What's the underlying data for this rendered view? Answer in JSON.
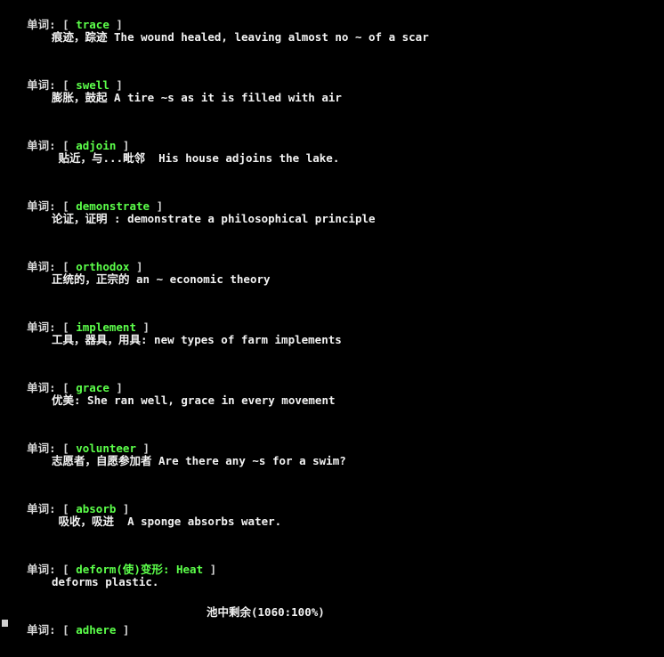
{
  "terminal": {
    "prefix": "单词:",
    "open_bracket": "[",
    "close_bracket": "]",
    "status": "池中剩余(1060:100%)",
    "colors": {
      "background": "#000000",
      "word": "#5cff4a",
      "text": "#f2f2f2"
    }
  },
  "entries": [
    {
      "word": "trace",
      "def": "痕迹，踪迹 The wound healed, leaving almost no ~ of a scar"
    },
    {
      "word": "swell",
      "def": "膨胀，鼓起 A tire ~s as it is filled with air"
    },
    {
      "word": "adjoin",
      "def": " 贴近，与...毗邻  His house adjoins the lake."
    },
    {
      "word": "demonstrate",
      "def": "论证，证明 : demonstrate a philosophical principle"
    },
    {
      "word": "orthodox",
      "def": "正统的，正宗的 an ~ economic theory"
    },
    {
      "word": "implement",
      "def": "工具，器具，用具: new types of farm implements"
    },
    {
      "word": "grace",
      "def": "优美: She ran well, grace in every movement"
    },
    {
      "word": "volunteer",
      "def": "志愿者，自愿参加者 Are there any ~s for a swim?"
    },
    {
      "word": "absorb",
      "def": " 吸收，吸进  A sponge absorbs water."
    },
    {
      "word": "deform(使)变形: Heat",
      "def": "deforms plastic."
    }
  ],
  "last_word": "adhere"
}
